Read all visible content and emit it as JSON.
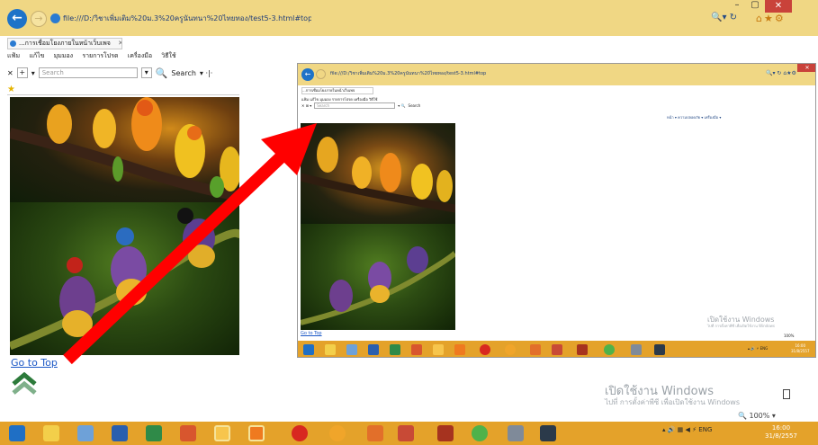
{
  "main": {
    "address": "file:///D:/วิชาเพิ่มเติม%20ม.3%20ครูนันทนา%20ไทยทอง/test5-3.html#top",
    "tab_label": "...การเชื่อมโยงภายในหน้าเว็บเพจ",
    "tab_close": "✕",
    "menu": [
      "แฟ้ม",
      "แก้ไข",
      "มุมมอง",
      "รายการโปรด",
      "เครื่องมือ",
      "วิธีใช้"
    ],
    "find_close": "✕",
    "find_placeholder": "Search",
    "find_search_label": "Search",
    "goto_top": "Go to Top",
    "watermark_title": "เปิดใช้งาน Windows",
    "watermark_sub": "ไปที่ การตั้งค่าพีซี เพื่อเปิดใช้งาน Windows",
    "zoom": "🔍 100%  ▾",
    "tray_lang": "ENG",
    "clock_time": "16:00",
    "clock_date": "31/8/2557",
    "window_min": "–",
    "window_max": "▢",
    "window_close": "✕"
  },
  "inset": {
    "address": "file:///D:/วิชาเพิ่มเติม%20ม.3%20ครูนันทนา%20ไทยทอง/test5-3.html#top",
    "tab_label": "...การเชื่อมโยงภายในหน้าเว็บเพจ",
    "menu": [
      "แฟ้ม",
      "แก้ไข",
      "มุมมอง",
      "รายการโปรด",
      "เครื่องมือ",
      "วิธีใช้"
    ],
    "find_placeholder": "Search",
    "find_search_label": "Search",
    "cmdbar": "หน้า ▾  ความปลอดภัย ▾  เครื่องมือ ▾",
    "goto_top": "Go to Top",
    "watermark_title": "เปิดใช้งาน Windows",
    "watermark_sub": "ไปที่ การตั้งค่าพีซี เพื่อเปิดใช้งาน Windows",
    "zoom": "100%",
    "tray_lang": "ENG",
    "clock_time": "16:00",
    "clock_date": "31/8/2557"
  },
  "colors": {
    "titlebar": "#f0d784",
    "taskbar": "#e4a22a",
    "link": "#1a57c6",
    "arrow": "#ff0000"
  },
  "icons": {
    "taskbar": [
      "start-icon",
      "file-explorer-icon",
      "notepad-icon",
      "word-icon",
      "excel-icon",
      "powerpoint-icon",
      "internet-explorer-icon",
      "firefox-icon",
      "opera-icon",
      "chrome-like-icon",
      "media-icon",
      "paint-icon",
      "app-icon",
      "app-icon-2",
      "printer-icon",
      "ie-pinned-icon"
    ]
  }
}
